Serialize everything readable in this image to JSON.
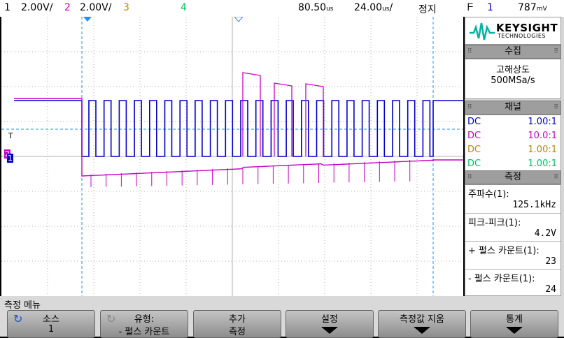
{
  "topbar": {
    "ch1_num": "1",
    "ch1_scale": "2.00V/",
    "ch2_num": "2",
    "ch2_scale": "2.00V/",
    "ch3_num": "3",
    "ch4_num": "4",
    "time_delay": "80.50",
    "time_scale": "24.00",
    "run_state": "정지",
    "trigger_icon": "ᖴ",
    "trigger_src": "1",
    "trigger_level": "787"
  },
  "colors": {
    "ch1": "#0000c8",
    "ch2": "#c800c8",
    "ch3": "#b8860b",
    "ch4": "#00c060",
    "cursor": "#1e90ff"
  },
  "logo": {
    "brand": "KEYSIGHT",
    "sub": "TECHNOLOGIES"
  },
  "acquire": {
    "title": "수집",
    "mode": "고해상도",
    "rate": "500MSa/s"
  },
  "channels": {
    "title": "채널",
    "rows": [
      {
        "coupling": "DC",
        "ratio": "1.00:1"
      },
      {
        "coupling": "DC",
        "ratio": "10.0:1"
      },
      {
        "coupling": "DC",
        "ratio": "1.00:1"
      },
      {
        "coupling": "DC",
        "ratio": "1.00:1"
      }
    ]
  },
  "measure": {
    "title": "측정",
    "items": [
      {
        "label": "주파수(1):",
        "value": "125.1kHz"
      },
      {
        "label": "피크-피크(1):",
        "value": "4.2V"
      },
      {
        "label": "+ 펄스 카운트(1):",
        "value": "23"
      },
      {
        "label": "- 펄스 카운트(1):",
        "value": "24"
      }
    ]
  },
  "menu": {
    "title": "측정 메뉴",
    "keys": [
      {
        "l1": "소스",
        "l2": "1"
      },
      {
        "l1": "유형:",
        "l2": "- 펄스 카운트"
      },
      {
        "l1": "추가",
        "l2": "측정"
      },
      {
        "l1": "설정",
        "l2": ""
      },
      {
        "l1": "측정값 지움",
        "l2": ""
      },
      {
        "l1": "통계",
        "l2": ""
      }
    ]
  },
  "markers": {
    "trigger": "T",
    "ch2": "2",
    "ch1": "1"
  }
}
